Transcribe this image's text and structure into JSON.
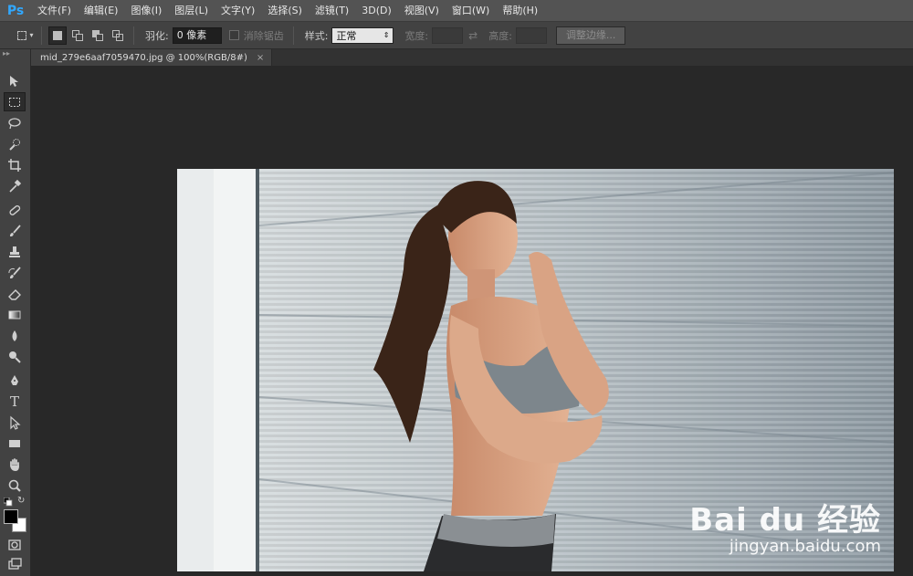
{
  "app": {
    "logo": "Ps"
  },
  "menu": [
    "文件(F)",
    "编辑(E)",
    "图像(I)",
    "图层(L)",
    "文字(Y)",
    "选择(S)",
    "滤镜(T)",
    "3D(D)",
    "视图(V)",
    "窗口(W)",
    "帮助(H)"
  ],
  "options": {
    "feather_label": "羽化:",
    "feather_value": "0 像素",
    "antialias_label": "消除锯齿",
    "style_label": "样式:",
    "style_value": "正常",
    "width_label": "宽度:",
    "height_label": "高度:",
    "refine_button": "调整边缘..."
  },
  "document": {
    "tab_title": "mid_279e6aaf7059470.jpg @ 100%(RGB/8#)",
    "close_glyph": "×"
  },
  "toolbox": {
    "header": "▸▸",
    "tools": [
      "move-tool",
      "marquee-tool",
      "lasso-tool",
      "quick-select-tool",
      "crop-tool",
      "eyedropper-tool",
      "healing-brush-tool",
      "brush-tool",
      "clone-stamp-tool",
      "history-brush-tool",
      "eraser-tool",
      "gradient-tool",
      "blur-tool",
      "dodge-tool",
      "pen-tool",
      "type-tool",
      "path-select-tool",
      "rectangle-tool",
      "hand-tool",
      "zoom-tool"
    ],
    "type_glyph": "T"
  },
  "colors": {
    "foreground": "#000000",
    "background": "#ffffff"
  },
  "watermark": {
    "top": "Bai du 经验",
    "bottom": "jingyan.baidu.com"
  }
}
